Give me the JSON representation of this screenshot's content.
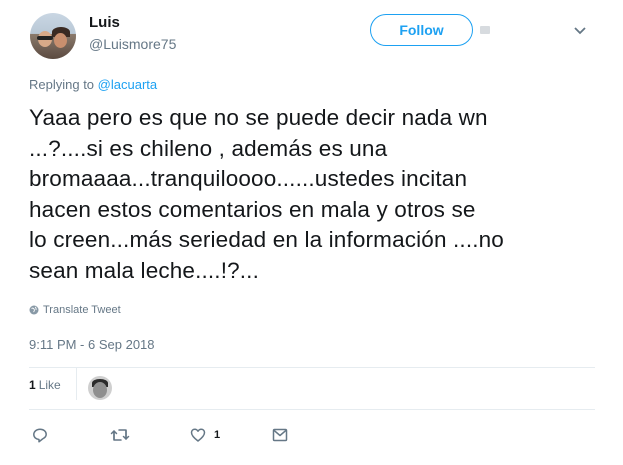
{
  "user": {
    "display_name": "Luis",
    "username": "@Luismore75"
  },
  "follow": {
    "label": "Follow"
  },
  "reply_context": {
    "prefix": "Replying to",
    "handle": "@lacuarta"
  },
  "tweet": {
    "text": "Yaaa pero es que no se puede decir nada wn\n...?....si es chileno , además es una\nbromaaaa...tranquiloooo......ustedes incitan\nhacen estos comentarios en mala y otros se\nlo creen...más seriedad en la información ....no\nsean mala leche....!?...",
    "translate_label": "Translate Tweet",
    "timestamp": "9:11 PM - 6 Sep 2018"
  },
  "stats": {
    "likes_count": "1",
    "likes_label": "Like"
  },
  "actions": {
    "like_count": "1"
  },
  "colors": {
    "accent": "#1da1f2",
    "secondary_text": "#657786",
    "primary_text": "#14171a",
    "divider": "#e6ecf0"
  },
  "icons": {
    "reply": "reply-icon",
    "retweet": "retweet-icon",
    "like": "heart-icon",
    "message": "envelope-icon",
    "more": "chevron-down-icon",
    "translate": "globe-icon"
  }
}
